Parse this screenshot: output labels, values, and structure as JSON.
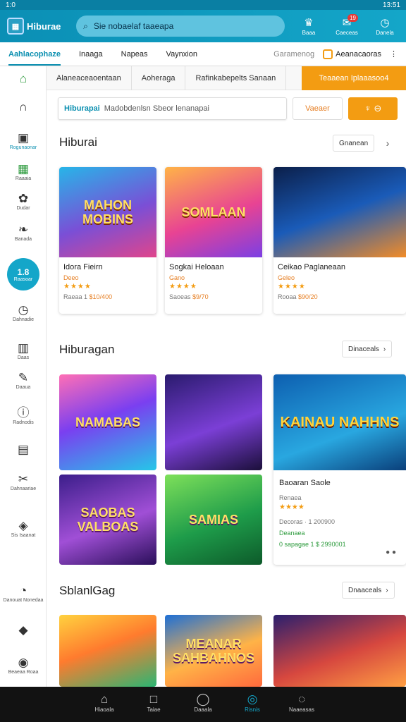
{
  "status": {
    "time": "1:0",
    "right": "13:51"
  },
  "header": {
    "app_name": "Hiburae",
    "search_text": "Sie nobaelaf taaeapa",
    "icons": [
      {
        "icon": "crown-icon",
        "glyph": "♛",
        "label": "Baaa",
        "badge": ""
      },
      {
        "icon": "message-icon",
        "glyph": "✉",
        "label": "Caeceas",
        "badge": "19"
      },
      {
        "icon": "clock-icon",
        "glyph": "◷",
        "label": "Danela",
        "badge": ""
      }
    ]
  },
  "tabs": {
    "items": [
      "Aahlacophaze",
      "Inaaga",
      "Napeas",
      "Vaynxion"
    ],
    "right_muted": "Garamenog",
    "right_account": "Aeanacaoras"
  },
  "sidebar": [
    {
      "icon": "home-icon",
      "glyph": "⌂",
      "label": "",
      "cls": "green"
    },
    {
      "icon": "arch-icon",
      "glyph": "∩",
      "label": "",
      "cls": ""
    },
    {
      "icon": "chat-icon",
      "glyph": "▣",
      "label": "Rogunaonar",
      "cls": "teal"
    },
    {
      "icon": "calendar-icon",
      "glyph": "▦",
      "label": "Raaaia",
      "cls": "green"
    },
    {
      "icon": "puzzle-icon",
      "glyph": "✿",
      "label": "Dudar",
      "cls": ""
    },
    {
      "icon": "leaf-icon",
      "glyph": "❧",
      "label": "Banada",
      "cls": ""
    },
    {
      "icon": "clock-icon",
      "glyph": "◷",
      "label": "Dahnadie",
      "cls": ""
    },
    {
      "icon": "building-icon",
      "glyph": "▥",
      "label": "Daas",
      "cls": ""
    },
    {
      "icon": "pen-icon",
      "glyph": "✎",
      "label": "Daaua",
      "cls": ""
    },
    {
      "icon": "info-icon",
      "glyph": "ⓘ",
      "label": "Radnodis",
      "cls": ""
    },
    {
      "icon": "chart-icon",
      "glyph": "▤",
      "label": "",
      "cls": ""
    },
    {
      "icon": "tools-icon",
      "glyph": "✂",
      "label": "Dahnaariae",
      "cls": ""
    },
    {
      "icon": "frame-icon",
      "glyph": "◈",
      "label": "Sis Isaanat",
      "cls": ""
    },
    {
      "icon": "bubble-icon",
      "glyph": "◔",
      "label": "Danouat Nonedaa",
      "cls": ""
    },
    {
      "icon": "tag-icon",
      "glyph": "◆",
      "label": "",
      "cls": ""
    },
    {
      "icon": "power-icon",
      "glyph": "◉",
      "label": "Beaeaa Roaa",
      "cls": ""
    }
  ],
  "sidebar_active": {
    "big": "1.8",
    "small": "Raasoar"
  },
  "filters": {
    "items": [
      "Alaneaceaoentaan",
      "Aoheraga",
      "Rafinkabepelts Sanaan"
    ],
    "orange": "Teaaean Iplaaasoo4"
  },
  "filter_input": {
    "label": "Hiburapai",
    "text": "Madobdenlsn Sbeor lenanapai",
    "button": "Vaeaer",
    "icon_button": "♆ ⊖"
  },
  "sections": [
    {
      "title": "Hiburai",
      "button": "Gnanean"
    },
    {
      "title": "Hiburagan",
      "button": "Dinaceals"
    },
    {
      "title": "SblanlGag",
      "button": "Dnaaceals"
    }
  ],
  "cards": [
    {
      "name": "Idora Fieirn",
      "sub": "Deeo",
      "stars": "★★★★",
      "meta": "Raeaa 1",
      "price": "$10/400",
      "art": "MAHON MOBINS"
    },
    {
      "name": "Sogkai Heloaan",
      "sub": "Gano",
      "stars": "★★★★",
      "meta": "Saoeas",
      "price": "$9/70",
      "art": "SOMLAAN"
    },
    {
      "name": "Ceikao Paglaneaan",
      "sub": "Geleo",
      "stars": "★★★★",
      "meta": "Rooaa",
      "price": "$90/20",
      "art": ""
    }
  ],
  "tiles": [
    {
      "art": "NAMABAS"
    },
    {
      "art": ""
    },
    {
      "art": "SAOBAS VALBOAS"
    },
    {
      "art": "SAMIAS"
    }
  ],
  "big_card": {
    "art": "KAINAU NAHHNS",
    "name": "Baoaran Saole",
    "line1": "Renaea",
    "stars": "★★★★",
    "line2": "Decoras · 1 200900",
    "line3": "Deanaea",
    "line4": "0 sapagae 1 $ 2990001"
  },
  "bottom_tiles": [
    {
      "art": ""
    },
    {
      "art": "MEANAR SAHBAHNOS"
    },
    {
      "art": ""
    }
  ],
  "nav": [
    {
      "icon": "home-icon",
      "glyph": "⌂",
      "label": "Hiaoala"
    },
    {
      "icon": "square-icon",
      "glyph": "□",
      "label": "Taiae"
    },
    {
      "icon": "shield-icon",
      "glyph": "◯",
      "label": "Daaala"
    },
    {
      "icon": "compass-icon",
      "glyph": "◎",
      "label": "Risnis",
      "active": true
    },
    {
      "icon": "chat-icon",
      "glyph": "◌",
      "label": "Naaeasas"
    }
  ],
  "colors": {
    "primary": "#14a6c9",
    "accent": "#f39c12",
    "nav_bg": "#121212"
  }
}
